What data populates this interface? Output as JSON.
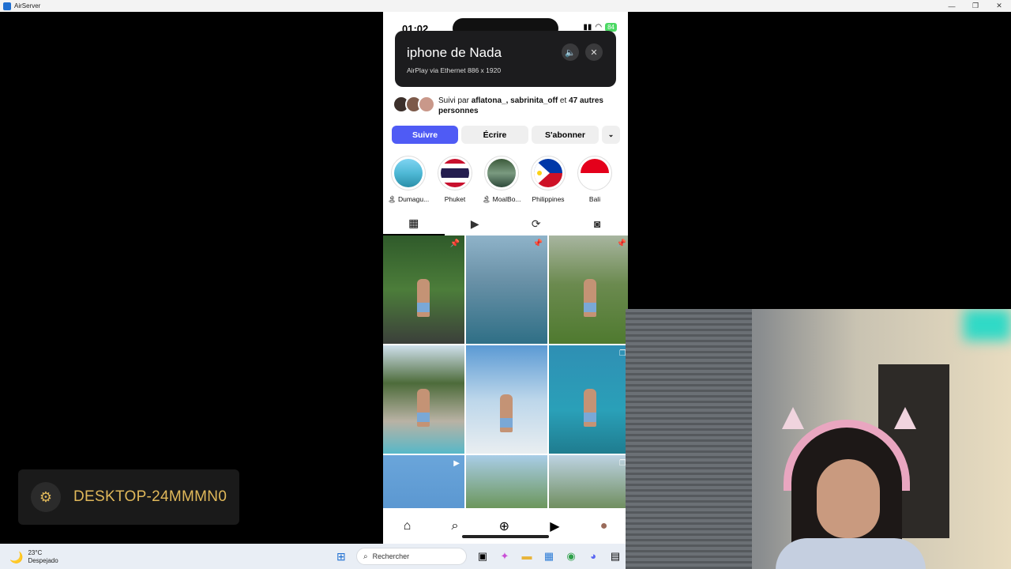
{
  "window": {
    "title": "AirServer",
    "controls": [
      "—",
      "❐",
      "✕"
    ]
  },
  "phone": {
    "status_time": "01:02",
    "battery": "84",
    "airplay": {
      "device_name": "iphone de Nada",
      "subtitle": "AirPlay via Ethernet 886 x 1920"
    },
    "followed_by": {
      "prefix": "Suivi par ",
      "names": "aflatona_, sabrinita_off",
      "mid": " et ",
      "rest": "47 autres personnes"
    },
    "actions": {
      "follow": "Suivre",
      "message": "Écrire",
      "subscribe": "S'abonner",
      "more": "⌄"
    },
    "highlights": [
      {
        "label": "🏝 Dumagu..."
      },
      {
        "label": "Phuket"
      },
      {
        "label": "🏝 MoalBo..."
      },
      {
        "label": "Philippines"
      },
      {
        "label": "Bali"
      }
    ],
    "tabs": [
      "▦",
      "▶",
      "⟳",
      "◙"
    ],
    "bottom_nav": [
      "⌂",
      "⌕",
      "⊕",
      "▶",
      "●"
    ]
  },
  "toast": {
    "computer_name": "DESKTOP-24MMMN0"
  },
  "taskbar": {
    "temperature": "23°C",
    "condition": "Despejado",
    "search_placeholder": "Rechercher"
  },
  "colors": {
    "follow_button": "#4f5bf5",
    "toast_text": "#e0b85a"
  }
}
